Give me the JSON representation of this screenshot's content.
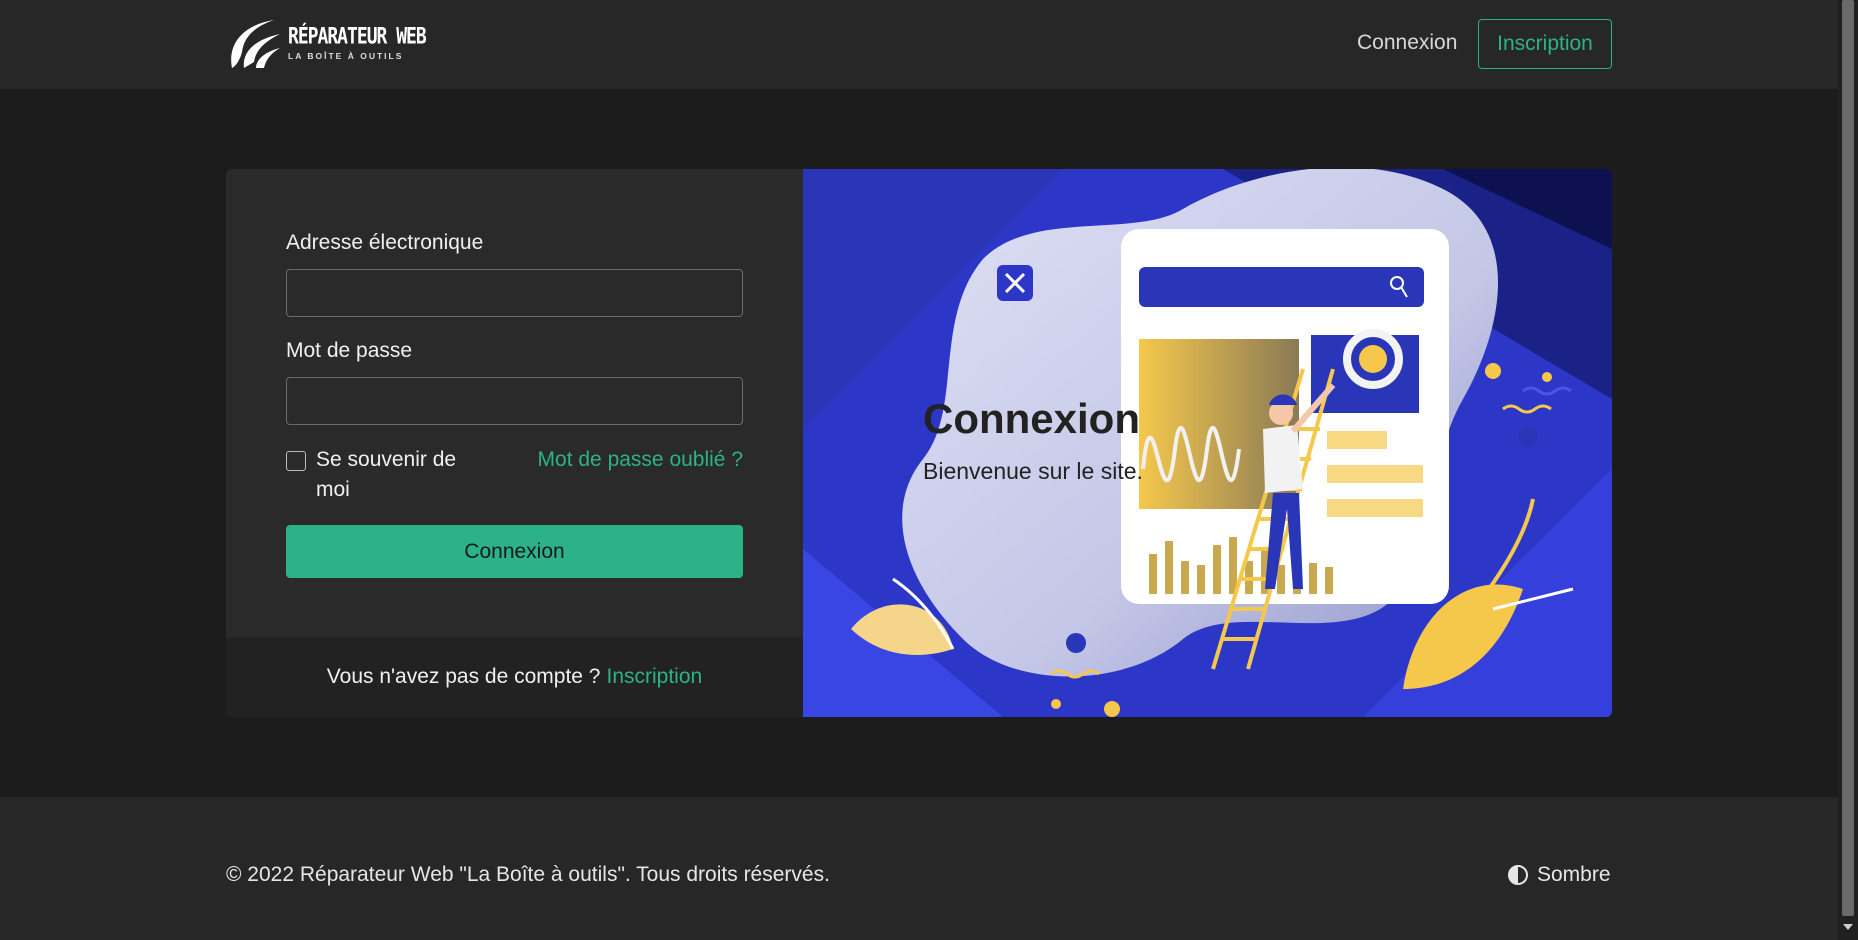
{
  "brand": {
    "logo_title": "RÉPARATEUR WEB",
    "logo_subtitle": "LA BOÎTE À OUTILS",
    "icon": "swoosh-logo"
  },
  "navbar": {
    "login_label": "Connexion",
    "signup_label": "Inscription"
  },
  "login_form": {
    "email_label": "Adresse électronique",
    "email_value": "",
    "password_label": "Mot de passe",
    "password_value": "",
    "remember_label": "Se souvenir de moi",
    "remember_checked": false,
    "forgot_label": "Mot de passe oublié ?",
    "submit_label": "Connexion"
  },
  "card_footer": {
    "text": "Vous n'avez pas de compte ?",
    "link_label": "Inscription"
  },
  "hero": {
    "title": "Connexion",
    "subtitle": "Bienvenue sur le site.",
    "illustration": "person-on-ladder-with-dashboard"
  },
  "footer": {
    "copyright": "© 2022 Réparateur Web \"La Boîte à outils\". Tous droits réservés.",
    "theme_label": "Sombre",
    "theme_icon": "contrast-icon"
  },
  "colors": {
    "accent": "#2cb287",
    "background": "#1c1c1c",
    "panel": "#2a2a2a",
    "hero_blue": "#2f3bd6",
    "hero_yellow": "#f5c84c"
  }
}
